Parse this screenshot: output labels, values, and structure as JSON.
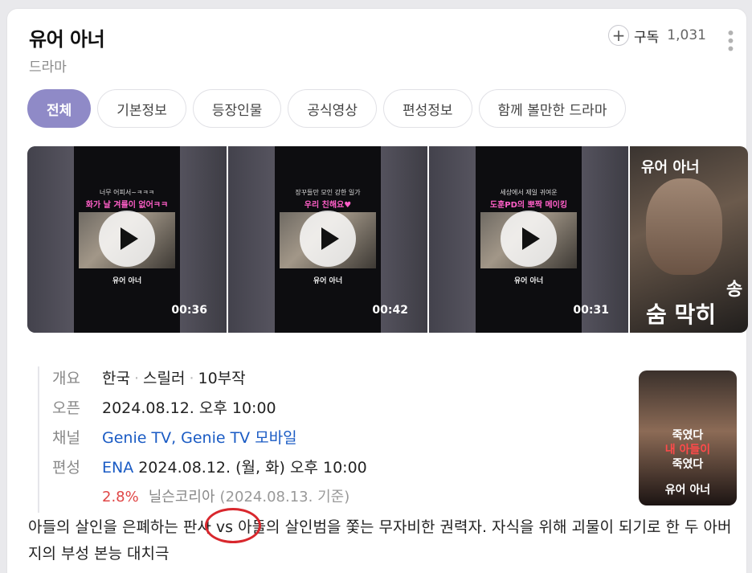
{
  "header": {
    "title": "유어 아너",
    "genre": "드라마",
    "subscribe_label": "구독",
    "subscribe_count": "1,031"
  },
  "tabs": [
    "전체",
    "기본정보",
    "등장인물",
    "공식영상",
    "편성정보",
    "함께 볼만한 드라마"
  ],
  "videos": [
    {
      "caption_top": "너무 어피서~ㅋㅋㅋ",
      "caption": "화가 날 겨를이 없어ㅋㅋ",
      "duration": "00:36",
      "logo": "유어 아너"
    },
    {
      "caption_top": "장꾸들만 모인 강한 일가",
      "caption": "우리 친해요♥",
      "duration": "00:42",
      "logo": "유어 아너"
    },
    {
      "caption_top": "세상에서 제일 귀여운",
      "caption": "도훈PD의 뽀짝 메이킹",
      "duration": "00:31",
      "logo": "유어 아너"
    }
  ],
  "poster": {
    "title": "유어 아너",
    "text": "숨 막히",
    "text2": "송"
  },
  "info": {
    "overview_label": "개요",
    "country": "한국",
    "genre": "스릴러",
    "episodes": "10부작",
    "premiere_label": "오픈",
    "premiere": "2024.08.12. 오후 10:00",
    "channel_label": "채널",
    "channel_1": "Genie TV,",
    "channel_2": "Genie TV 모바일",
    "schedule_label": "편성",
    "schedule_channel": "ENA",
    "schedule_time": "2024.08.12. (월, 화) 오후 10:00",
    "rating": "2.8%",
    "rating_source": "닐슨코리아",
    "rating_date": "(2024.08.13. 기준)"
  },
  "small_poster": {
    "line1": "죽였다",
    "line2": "내 아들이",
    "line3": "죽였다",
    "line4": "유어 아너"
  },
  "description": "아들의 살인을 은폐하는 판사 vs 아들의 살인범을 쫓는 무자비한 권력자. 자식을 위해 괴물이 되기로 한 두 아버지의 부성 본능 대치극"
}
